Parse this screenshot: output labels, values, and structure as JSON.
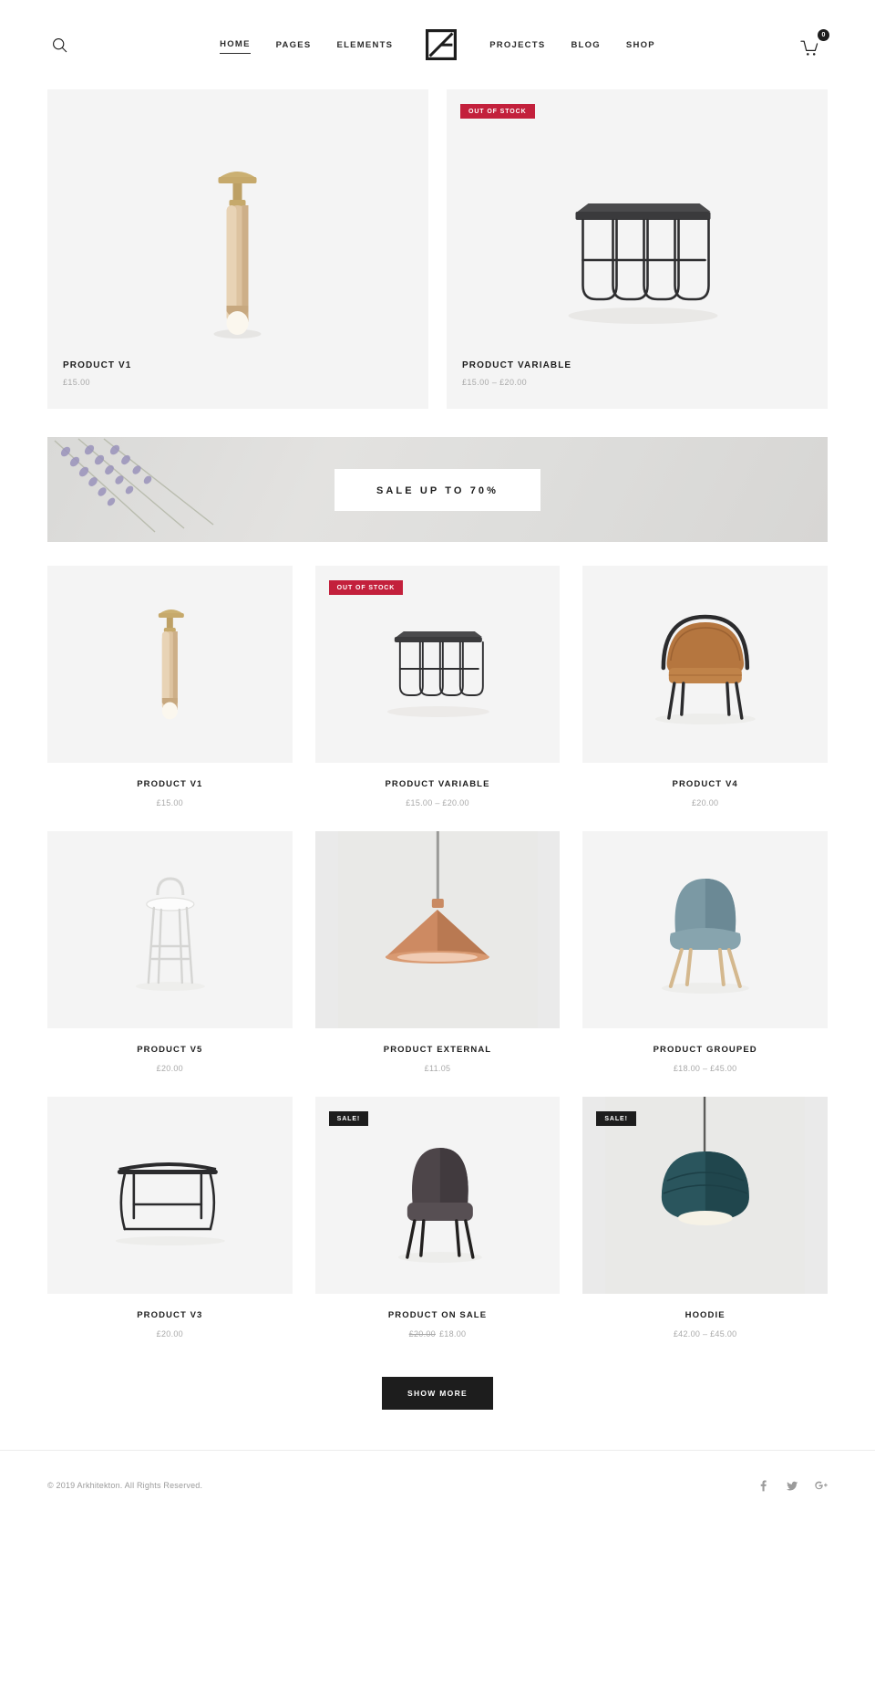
{
  "header": {
    "search_icon": "search-icon",
    "logo_alt": "arkhitekton-logo",
    "nav_left": [
      {
        "label": "HOME",
        "active": true
      },
      {
        "label": "PAGES",
        "active": false
      },
      {
        "label": "ELEMENTS",
        "active": false
      }
    ],
    "nav_right": [
      {
        "label": "PROJECTS",
        "active": false
      },
      {
        "label": "BLOG",
        "active": false
      },
      {
        "label": "SHOP",
        "active": false
      }
    ],
    "cart": {
      "icon": "shopping-cart-icon",
      "count": "0"
    }
  },
  "featured": [
    {
      "title": "PRODUCT V1",
      "price": "£15.00",
      "badge": "",
      "badge_type": "",
      "image": "wood-ceiling-lamp"
    },
    {
      "title": "PRODUCT VARIABLE",
      "price": "£15.00 – £20.00",
      "badge": "OUT OF STOCK",
      "badge_type": "oos",
      "image": "black-wire-side-table"
    }
  ],
  "banner": {
    "text": "SALE UP TO 70%",
    "image": "lavender-sprigs-on-concrete"
  },
  "products": [
    {
      "title": "PRODUCT V1",
      "price": "£15.00",
      "old_price": "",
      "badge": "",
      "badge_type": "",
      "image": "wood-ceiling-lamp",
      "bg": "light"
    },
    {
      "title": "PRODUCT VARIABLE",
      "price": "£15.00 – £20.00",
      "old_price": "",
      "badge": "OUT OF STOCK",
      "badge_type": "oos",
      "image": "black-wire-side-table",
      "bg": "light"
    },
    {
      "title": "PRODUCT V4",
      "price": "£20.00",
      "old_price": "",
      "badge": "",
      "badge_type": "",
      "image": "tan-leather-armchair",
      "bg": "light"
    },
    {
      "title": "PRODUCT V5",
      "price": "£20.00",
      "old_price": "",
      "badge": "",
      "badge_type": "",
      "image": "white-bar-stool",
      "bg": "light"
    },
    {
      "title": "PRODUCT EXTERNAL",
      "price": "£11.05",
      "old_price": "",
      "badge": "",
      "badge_type": "",
      "image": "copper-pendant-lamp",
      "bg": "grey"
    },
    {
      "title": "PRODUCT GROUPED",
      "price": "£18.00 – £45.00",
      "old_price": "",
      "badge": "",
      "badge_type": "",
      "image": "blue-shell-chair",
      "bg": "light"
    },
    {
      "title": "PRODUCT V3",
      "price": "£20.00",
      "old_price": "",
      "badge": "",
      "badge_type": "",
      "image": "black-coffee-table",
      "bg": "light"
    },
    {
      "title": "PRODUCT ON SALE",
      "price": "£18.00",
      "old_price": "£20.00",
      "badge": "SALE!",
      "badge_type": "sale",
      "image": "grey-dining-chair",
      "bg": "light"
    },
    {
      "title": "HOODIE",
      "price": "£42.00 – £45.00",
      "old_price": "",
      "badge": "SALE!",
      "badge_type": "sale",
      "image": "teal-dome-pendant-lamp",
      "bg": "grey"
    }
  ],
  "show_more": {
    "label": "SHOW MORE"
  },
  "footer": {
    "copyright": "© 2019 Arkhitekton. All Rights Reserved.",
    "socials": [
      {
        "name": "facebook-icon",
        "glyph": "f"
      },
      {
        "name": "twitter-icon",
        "glyph": "t"
      },
      {
        "name": "google-plus-icon",
        "glyph": "g"
      }
    ]
  },
  "colors": {
    "accent_oos": "#c3203c",
    "accent_sale": "#1d1d1d",
    "text": "#1d1d1d",
    "muted": "#a9a9a9",
    "card_bg": "#f4f4f4"
  }
}
